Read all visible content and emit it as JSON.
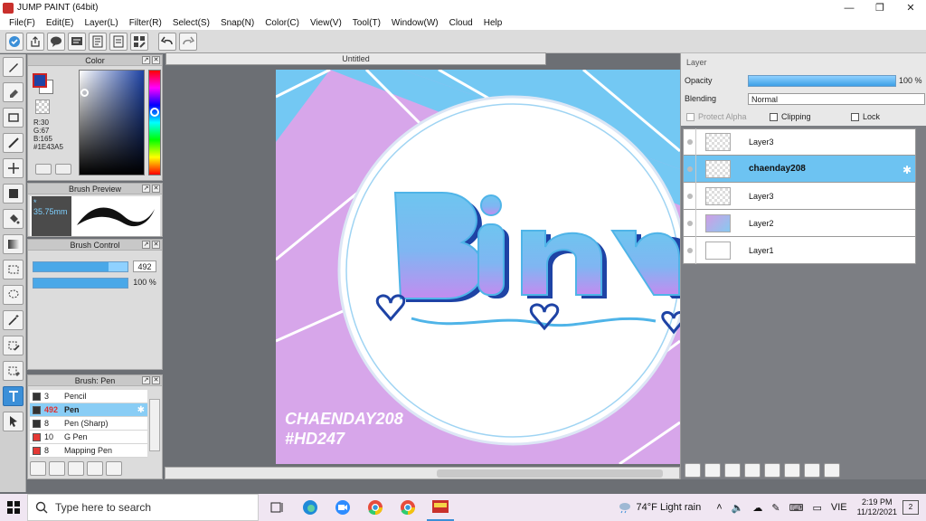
{
  "window": {
    "title": "JUMP PAINT (64bit)"
  },
  "menu": [
    "File(F)",
    "Edit(E)",
    "Layer(L)",
    "Filter(R)",
    "Select(S)",
    "Snap(N)",
    "Color(C)",
    "View(V)",
    "Tool(T)",
    "Window(W)",
    "Cloud",
    "Help"
  ],
  "color_panel": {
    "title": "Color",
    "r": "R:30",
    "g": "G:67",
    "b": "B:165",
    "hex": "#1E43A5",
    "fg_color": "#1E43A5"
  },
  "brush_preview": {
    "title": "Brush Preview",
    "size": "35.75mm"
  },
  "brush_control": {
    "title": "Brush Control",
    "size_value": "492",
    "size_fraction": 0.8,
    "opacity_value": "100 %",
    "opacity_fraction": 1.0
  },
  "brush_list": {
    "title": "Brush: Pen",
    "items": [
      {
        "size": "3",
        "name": "Pencil",
        "color": "#333333",
        "selected": false
      },
      {
        "size": "492",
        "name": "Pen",
        "color": "#333333",
        "selected": true
      },
      {
        "size": "8",
        "name": "Pen (Sharp)",
        "color": "#333333",
        "selected": false
      },
      {
        "size": "10",
        "name": "G Pen",
        "color": "#e53935",
        "selected": false
      },
      {
        "size": "8",
        "name": "Mapping Pen",
        "color": "#e53935",
        "selected": false
      }
    ]
  },
  "document": {
    "tab": "Untitled"
  },
  "artwork": {
    "title_text": "Biin",
    "watermark_line1": "CHAENDAY208",
    "watermark_line2": "#HD247"
  },
  "layer_panel": {
    "title": "Layer",
    "opacity_label": "Opacity",
    "opacity_value": "100 %",
    "blending_label": "Blending",
    "blending_value": "Normal",
    "protect_alpha": "Protect Alpha",
    "clipping": "Clipping",
    "lock": "Lock",
    "layers": [
      {
        "name": "Layer3",
        "selected": false,
        "thumb": "checker"
      },
      {
        "name": "chaenday208",
        "selected": true,
        "thumb": "checker"
      },
      {
        "name": "Layer3",
        "selected": false,
        "thumb": "checker"
      },
      {
        "name": "Layer2",
        "selected": false,
        "thumb": "purple"
      },
      {
        "name": "Layer1",
        "selected": false,
        "thumb": "blank"
      }
    ]
  },
  "taskbar": {
    "search_placeholder": "Type here to search",
    "weather": "74°F  Light rain",
    "lang": "VIE",
    "time": "2:19 PM",
    "date": "11/12/2021",
    "notifications": "2"
  }
}
